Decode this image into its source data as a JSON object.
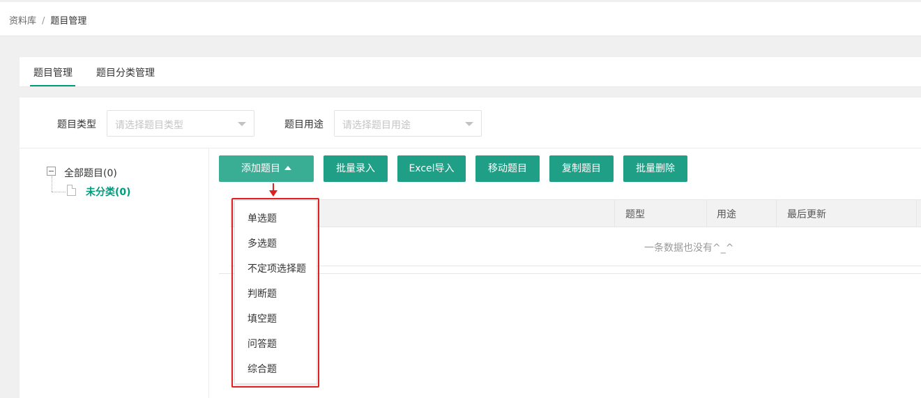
{
  "breadcrumb": {
    "root": "资料库",
    "separator": "/",
    "current": "题目管理"
  },
  "tabs": [
    {
      "label": "题目管理",
      "active": true
    },
    {
      "label": "题目分类管理",
      "active": false
    }
  ],
  "filters": {
    "type": {
      "label": "题目类型",
      "placeholder": "请选择题目类型"
    },
    "usage": {
      "label": "题目用途",
      "placeholder": "请选择题目用途"
    }
  },
  "tree": {
    "root": "全部题目(0)",
    "child": "未分类(0)"
  },
  "toolbar": {
    "add": "添加题目",
    "batch_entry": "批量录入",
    "excel_import": "Excel导入",
    "move": "移动题目",
    "copy": "复制题目",
    "batch_delete": "批量删除"
  },
  "table": {
    "columns": [
      "题型",
      "用途",
      "最后更新"
    ],
    "empty_text": "一条数据也没有^_^"
  },
  "add_menu": {
    "items": [
      "单选题",
      "多选题",
      "不定项选择题",
      "判断题",
      "填空题",
      "问答题",
      "综合题"
    ]
  },
  "colors": {
    "accent": "#009a7d",
    "button": "#1e9f86",
    "annotation": "#e02020"
  }
}
